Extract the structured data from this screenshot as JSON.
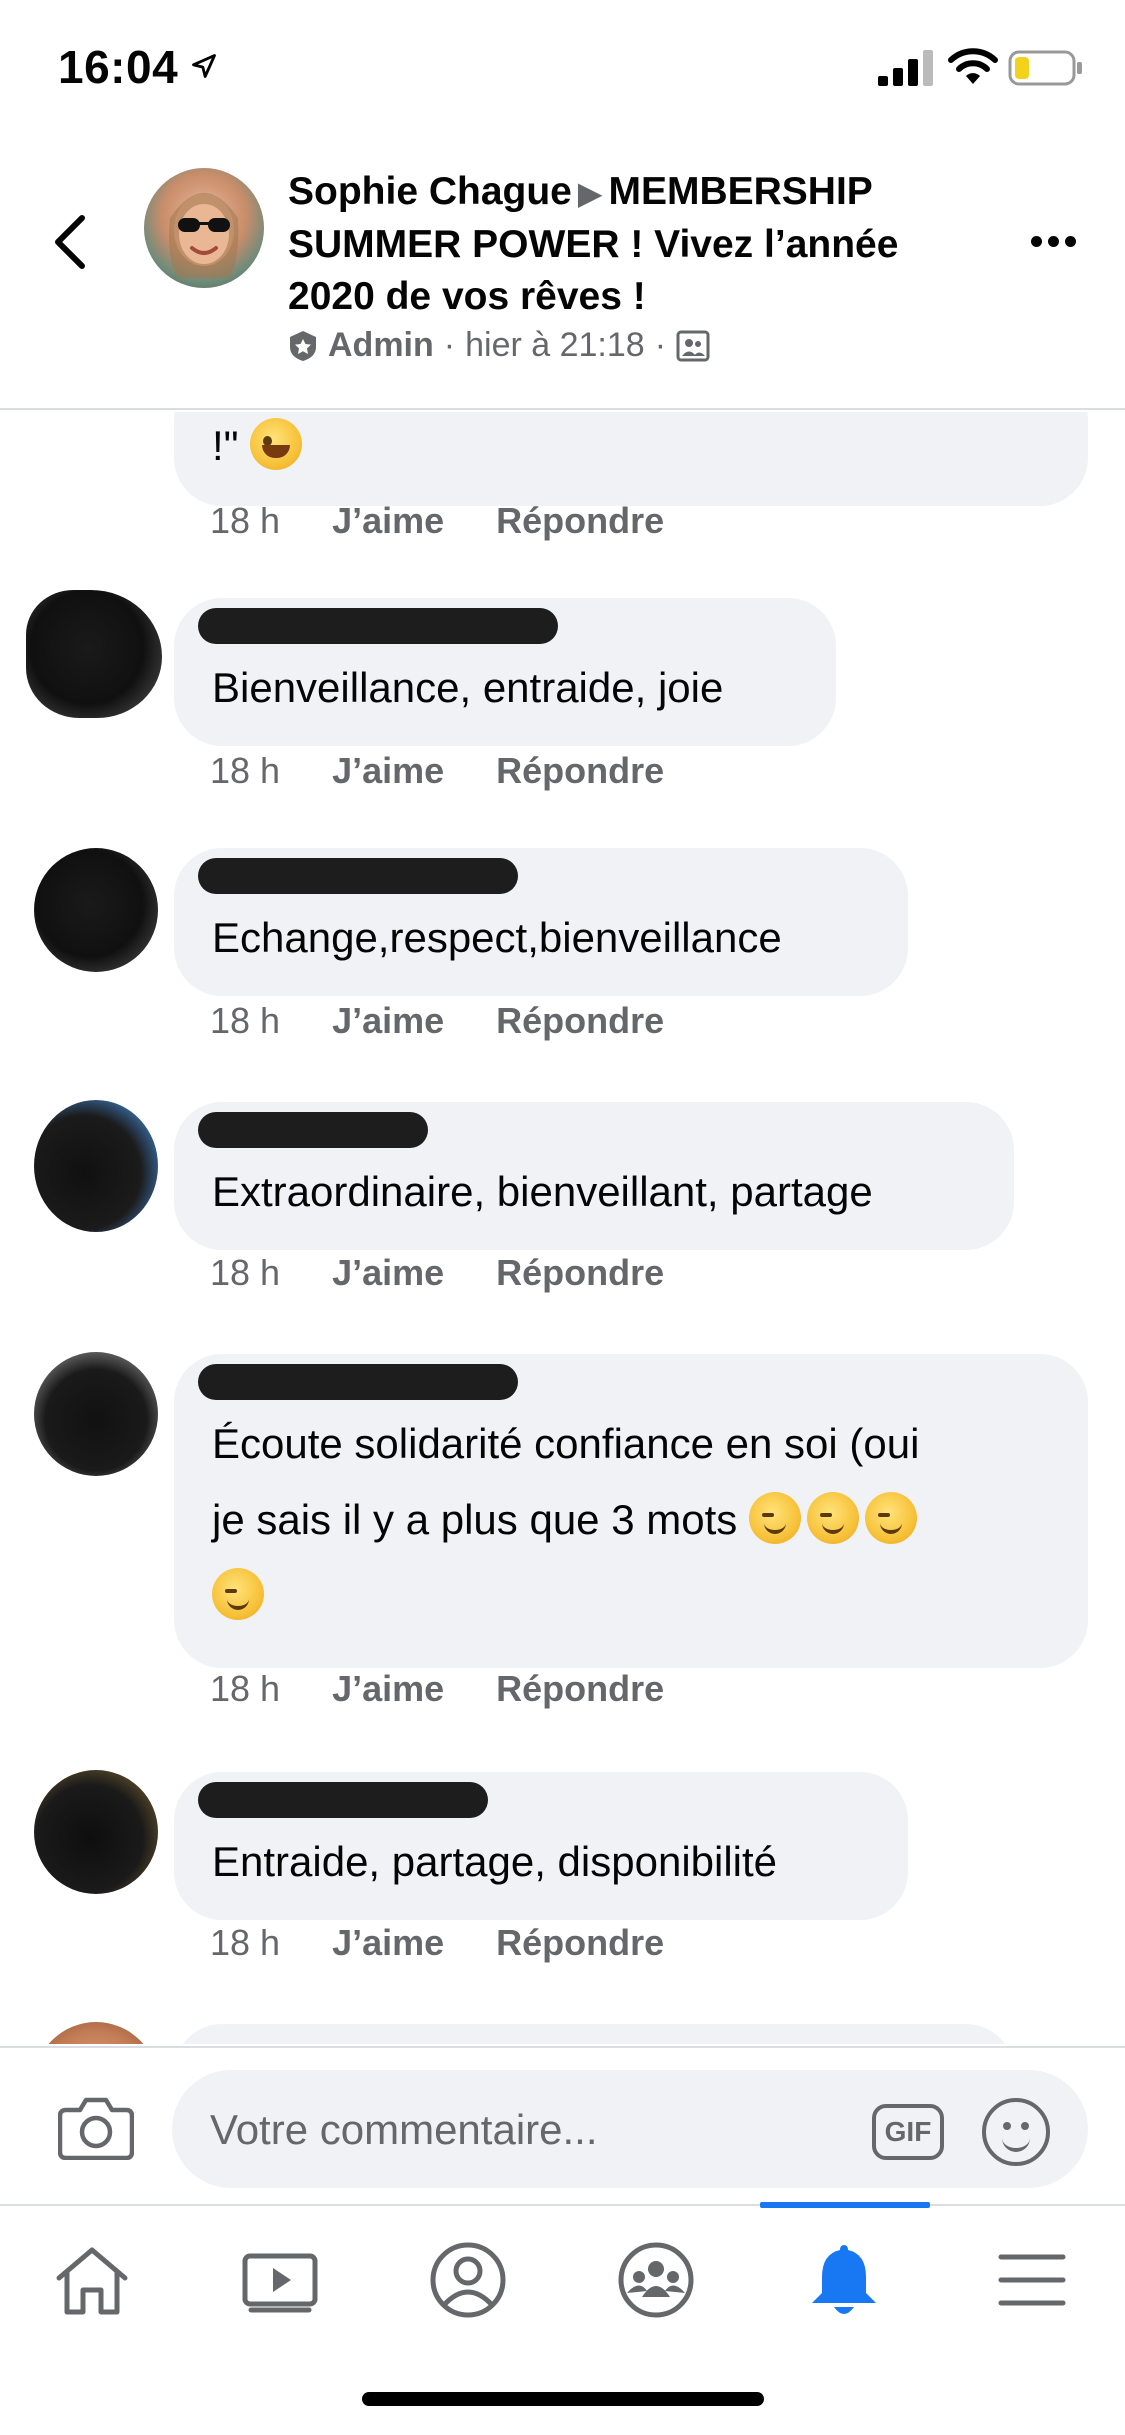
{
  "status_bar": {
    "time": "16:04"
  },
  "header": {
    "author": "Sophie Chague",
    "separator": "▶",
    "group_name": "MEMBERSHIP SUMMER POWER ! Vivez l’année 2020 de vos rêves !",
    "role": "Admin",
    "dot1": "·",
    "timestamp": "hier à 21:18",
    "dot2": "·"
  },
  "comments": [
    {
      "text": "!\"",
      "time": "18 h",
      "like_label": "J’aime",
      "reply_label": "Répondre"
    },
    {
      "text": "Bienveillance, entraide, joie",
      "time": "18 h",
      "like_label": "J’aime",
      "reply_label": "Répondre"
    },
    {
      "text": "Echange,respect,bienveillance",
      "time": "18 h",
      "like_label": "J’aime",
      "reply_label": "Répondre"
    },
    {
      "text": "Extraordinaire, bienveillant, partage",
      "time": "18 h",
      "like_label": "J’aime",
      "reply_label": "Répondre"
    },
    {
      "text_line1": "Écoute  solidarité confiance en soi (oui",
      "text_line2": "je sais il y a plus que 3 mots",
      "time": "18 h",
      "like_label": "J’aime",
      "reply_label": "Répondre"
    },
    {
      "text": "Entraide, partage, disponibilité",
      "time": "18 h",
      "like_label": "J’aime",
      "reply_label": "Répondre"
    }
  ],
  "input_bar": {
    "placeholder": "Votre commentaire...",
    "gif_label": "GIF"
  },
  "tab_bar": {
    "active_tab": "notifications",
    "active_color": "#1877f2",
    "icon_color": "#65676b"
  },
  "colors": {
    "bubble_bg": "#f0f2f5",
    "secondary_text": "#65676b",
    "accent": "#1877f2"
  }
}
